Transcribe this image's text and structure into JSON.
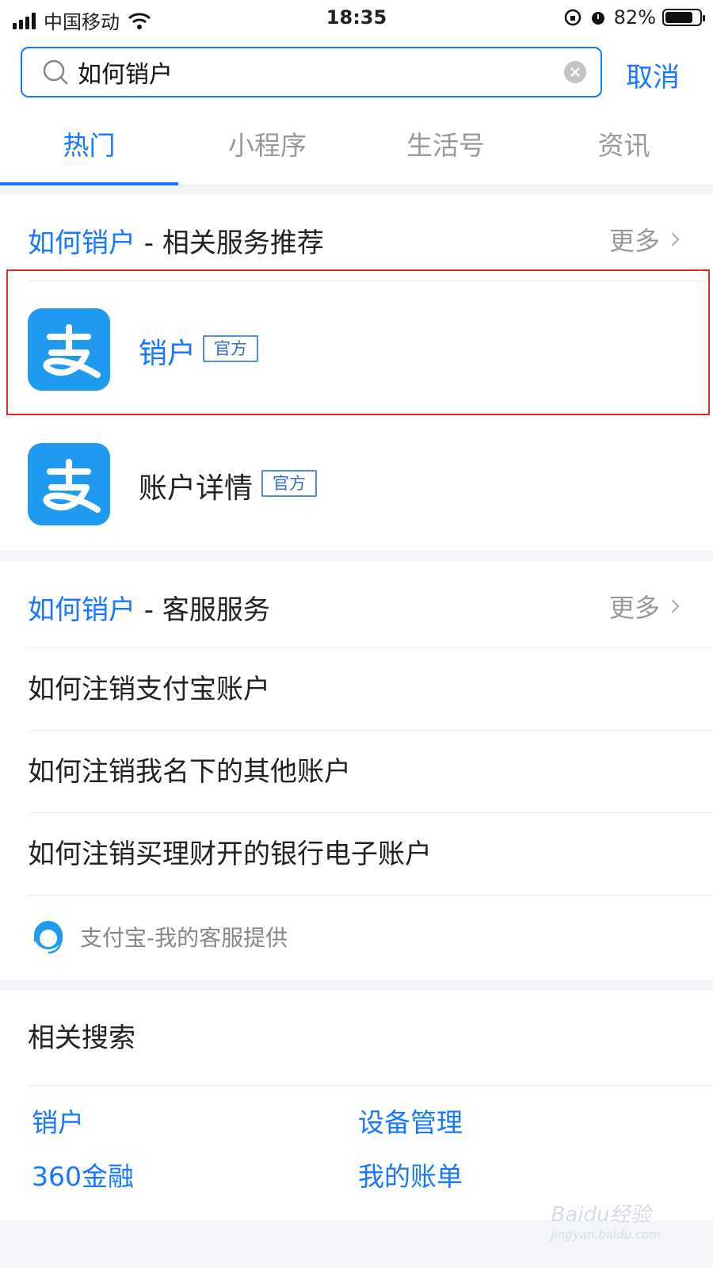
{
  "status_bar": {
    "carrier": "中国移动",
    "time": "18:35",
    "battery_percent": "82%",
    "battery_level": 0.82
  },
  "search": {
    "query": "如何销户",
    "cancel_label": "取消"
  },
  "tabs": [
    {
      "label": "热门",
      "active": true
    },
    {
      "label": "小程序",
      "active": false
    },
    {
      "label": "生活号",
      "active": false
    },
    {
      "label": "资讯",
      "active": false
    }
  ],
  "services_section": {
    "keyword": "如何销户",
    "title_suffix": " - 相关服务推荐",
    "more_label": "更多",
    "items": [
      {
        "name": "销户",
        "tag": "官方",
        "highlighted": true,
        "icon": "alipay-icon"
      },
      {
        "name": "账户详情",
        "tag": "官方",
        "highlighted": false,
        "icon": "alipay-icon"
      }
    ]
  },
  "customer_service_section": {
    "keyword": "如何销户",
    "title_suffix": " - 客服服务",
    "more_label": "更多",
    "questions": [
      "如何注销支付宝账户",
      "如何注销我名下的其他账户",
      "如何注销买理财开的银行电子账户"
    ],
    "provider": "支付宝-我的客服提供"
  },
  "related_searches": {
    "title": "相关搜索",
    "items": [
      "销户",
      "设备管理",
      "360金融",
      "我的账单"
    ]
  },
  "watermark": {
    "text": "Baidu经验",
    "sub": "jingyan.baidu.com"
  },
  "colors": {
    "accent": "#1677ff",
    "alipay_blue": "#1e9bf0",
    "highlight_red": "#e02a2a"
  }
}
